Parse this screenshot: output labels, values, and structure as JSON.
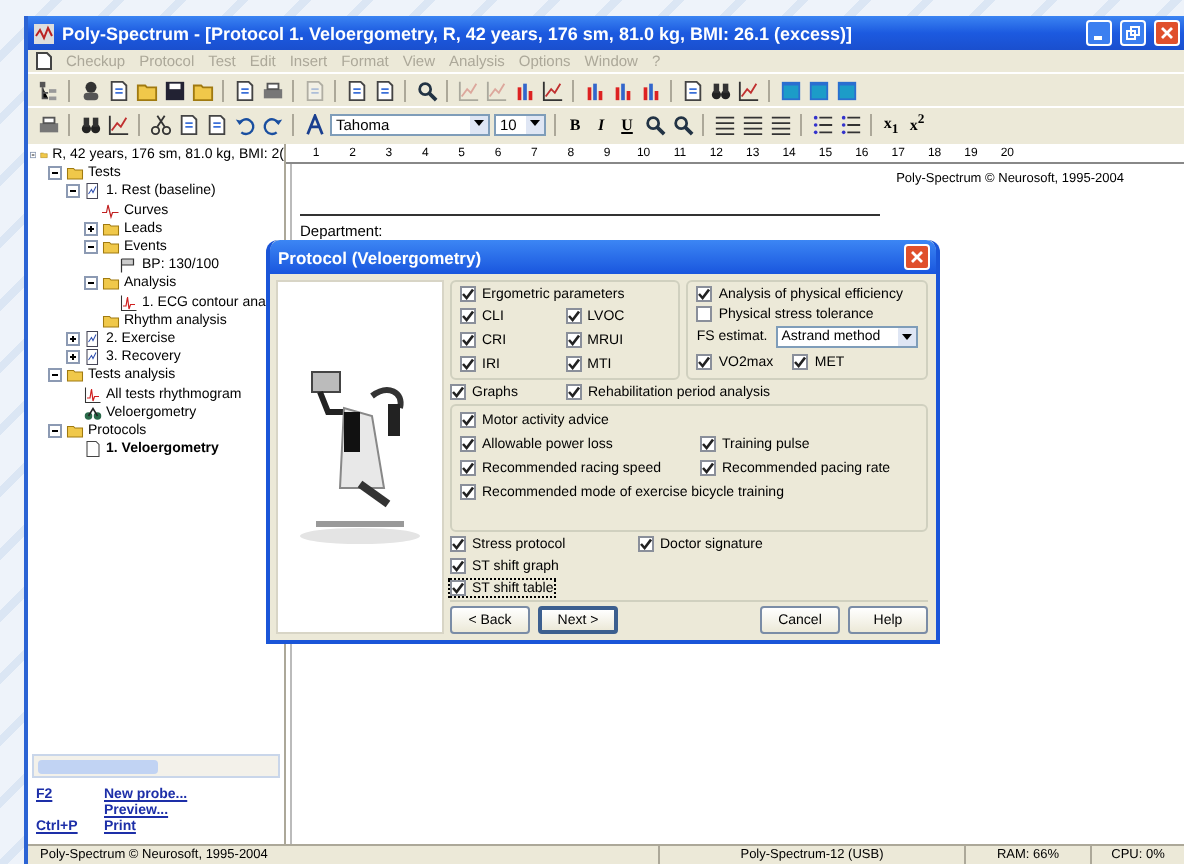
{
  "window": {
    "title": "Poly-Spectrum - [Protocol 1. Veloergometry, R, 42 years, 176 sm, 81.0 kg, BMI: 26.1 (excess)]"
  },
  "menu": [
    {
      "label": "Checkup",
      "disabled": true
    },
    {
      "label": "Protocol",
      "disabled": true
    },
    {
      "label": "Test",
      "disabled": true
    },
    {
      "label": "Edit",
      "disabled": true
    },
    {
      "label": "Insert",
      "disabled": true
    },
    {
      "label": "Format",
      "disabled": true
    },
    {
      "label": "View",
      "disabled": true
    },
    {
      "label": "Analysis",
      "disabled": true
    },
    {
      "label": "Options",
      "disabled": true
    },
    {
      "label": "Window",
      "disabled": true
    },
    {
      "label": "?",
      "disabled": true
    }
  ],
  "toolbar_1": [
    {
      "kind": "tree",
      "disabled": false
    },
    {
      "kind": "sep"
    },
    {
      "kind": "person",
      "disabled": false
    },
    {
      "kind": "doc",
      "disabled": false
    },
    {
      "kind": "folder",
      "disabled": false
    },
    {
      "kind": "save",
      "disabled": false
    },
    {
      "kind": "folder",
      "disabled": false
    },
    {
      "kind": "sep"
    },
    {
      "kind": "doc",
      "disabled": false
    },
    {
      "kind": "print",
      "disabled": false
    },
    {
      "kind": "sep"
    },
    {
      "kind": "doc",
      "disabled": true
    },
    {
      "kind": "sep"
    },
    {
      "kind": "doc",
      "disabled": false
    },
    {
      "kind": "doc",
      "disabled": false
    },
    {
      "kind": "sep"
    },
    {
      "kind": "search",
      "disabled": false
    },
    {
      "kind": "sep"
    },
    {
      "kind": "chart",
      "disabled": true
    },
    {
      "kind": "chart",
      "disabled": true
    },
    {
      "kind": "bars",
      "disabled": false
    },
    {
      "kind": "chart",
      "disabled": false
    },
    {
      "kind": "sep"
    },
    {
      "kind": "bars",
      "disabled": false
    },
    {
      "kind": "bars",
      "disabled": false
    },
    {
      "kind": "bars",
      "disabled": false
    },
    {
      "kind": "sep"
    },
    {
      "kind": "doc",
      "disabled": false
    },
    {
      "kind": "binoculars",
      "disabled": false
    },
    {
      "kind": "chart",
      "disabled": false
    },
    {
      "kind": "sep"
    },
    {
      "kind": "window",
      "disabled": false
    },
    {
      "kind": "window",
      "disabled": false
    },
    {
      "kind": "window",
      "disabled": false
    }
  ],
  "toolbar_2": {
    "before": [
      {
        "kind": "print",
        "disabled": false
      },
      {
        "kind": "sep"
      },
      {
        "kind": "binoculars",
        "disabled": false
      },
      {
        "kind": "chart",
        "disabled": false
      },
      {
        "kind": "sep"
      },
      {
        "kind": "cut",
        "disabled": false
      },
      {
        "kind": "doc",
        "disabled": false
      },
      {
        "kind": "doc",
        "disabled": false
      },
      {
        "kind": "undo",
        "disabled": false
      },
      {
        "kind": "redo",
        "disabled": false
      },
      {
        "kind": "sep"
      },
      {
        "kind": "font",
        "disabled": false
      }
    ],
    "font": "Tahoma",
    "size": "10",
    "format": [
      "B",
      "I",
      "U"
    ],
    "after": [
      {
        "kind": "search",
        "disabled": false
      },
      {
        "kind": "search",
        "disabled": false
      },
      {
        "kind": "sep"
      },
      {
        "kind": "align",
        "disabled": false
      },
      {
        "kind": "align",
        "disabled": false
      },
      {
        "kind": "align",
        "disabled": false
      },
      {
        "kind": "sep"
      },
      {
        "kind": "list",
        "disabled": false
      },
      {
        "kind": "list",
        "disabled": false
      },
      {
        "kind": "sep"
      }
    ],
    "scripts": [
      "x$_{1}$",
      "x$^{2}$"
    ]
  },
  "tree": [
    {
      "label": "R, 42 years, 176 sm, 81.0 kg, BMI: 2(",
      "kind": "folder",
      "expanded": true,
      "children": [
        {
          "label": "Tests",
          "kind": "folder",
          "expanded": true,
          "children": [
            {
              "label": "1. Rest (baseline)",
              "kind": "test",
              "expanded": true,
              "children": [
                {
                  "label": "Curves",
                  "kind": "curve"
                },
                {
                  "label": "Leads",
                  "kind": "folder",
                  "expanded": false
                },
                {
                  "label": "Events",
                  "kind": "folder",
                  "expanded": true,
                  "children": [
                    {
                      "label": "BP: 130/100",
                      "kind": "events"
                    }
                  ]
                },
                {
                  "label": "Analysis",
                  "kind": "folder",
                  "expanded": true,
                  "children": [
                    {
                      "label": "1. ECG contour ana",
                      "kind": "ecg"
                    }
                  ]
                },
                {
                  "label": "Rhythm analysis",
                  "kind": "folder"
                }
              ]
            },
            {
              "label": "2. Exercise",
              "kind": "test",
              "expanded": false
            },
            {
              "label": "3. Recovery",
              "kind": "test",
              "expanded": false
            }
          ]
        },
        {
          "label": "Tests analysis",
          "kind": "folder",
          "expanded": true,
          "children": [
            {
              "label": "All tests rhythmogram",
              "kind": "ecg"
            },
            {
              "label": "Veloergometry",
              "kind": "bike"
            }
          ]
        },
        {
          "label": "Protocols",
          "kind": "folder",
          "expanded": true,
          "children": [
            {
              "label": "1. Veloergometry",
              "kind": "protocol"
            }
          ]
        }
      ]
    }
  ],
  "shortcuts": [
    {
      "key": "F2",
      "action": "New probe..."
    },
    {
      "action": "Preview..."
    },
    {
      "key": "Ctrl+P",
      "action": "Print"
    }
  ],
  "ruler": [
    "1",
    "2",
    "3",
    "4",
    "5",
    "6",
    "7",
    "8",
    "9",
    "10",
    "11",
    "12",
    "13",
    "14",
    "15",
    "16",
    "17",
    "18",
    "19",
    "20"
  ],
  "document": {
    "copyright": "Poly-Spectrum © Neurosoft, 1995-2004",
    "department": "Department:"
  },
  "dialog": {
    "title": "Protocol (Veloergometry)",
    "left_group": {
      "header": {
        "label": "Ergometric parameters",
        "checked": true
      },
      "rows": [
        [
          {
            "label": "CLI",
            "checked": true
          },
          {
            "label": "LVOC",
            "checked": true
          }
        ],
        [
          {
            "label": "CRI",
            "checked": true
          },
          {
            "label": "MRUI",
            "checked": true
          }
        ],
        [
          {
            "label": "IRI",
            "checked": true
          },
          {
            "label": "MTI",
            "checked": true
          }
        ]
      ]
    },
    "right_group": {
      "header": {
        "label": "Analysis of physical efficiency",
        "checked": true
      },
      "option": {
        "label": "Physical stress tolerance",
        "checked": false
      },
      "estimate_label": "FS estimat.",
      "estimate_value": "Astrand method",
      "measures": [
        {
          "label": "VO2max",
          "checked": true
        },
        {
          "label": "MET",
          "checked": true
        }
      ]
    },
    "middle_row": [
      {
        "label": "Graphs",
        "checked": true
      },
      {
        "label": "Rehabilitation period analysis",
        "checked": true
      }
    ],
    "advice_group": [
      [
        {
          "label": "Motor activity advice",
          "checked": true
        }
      ],
      [
        {
          "label": "Allowable power loss",
          "checked": true
        },
        {
          "label": "Training pulse",
          "checked": true
        }
      ],
      [
        {
          "label": "Recommended racing speed",
          "checked": true
        },
        {
          "label": "Recommended pacing rate",
          "checked": true
        }
      ],
      [
        {
          "label": "Recommended mode of exercise bicycle training",
          "checked": true
        }
      ]
    ],
    "bottom_rows": [
      [
        {
          "label": "Stress protocol",
          "checked": true,
          "focused": false
        },
        {
          "label": "Doctor signature",
          "checked": true,
          "focused": false
        }
      ],
      [
        {
          "label": "ST shift graph",
          "checked": true,
          "focused": false
        }
      ],
      [
        {
          "label": "ST shift table",
          "checked": true,
          "focused": true
        }
      ]
    ],
    "buttons": [
      {
        "label": "< Back",
        "default": false
      },
      {
        "label": "Next >",
        "default": true
      },
      {
        "label": "Cancel",
        "default": false
      },
      {
        "label": "Help",
        "default": false
      }
    ]
  },
  "status_bar": [
    "Poly-Spectrum © Neurosoft, 1995-2004",
    "Poly-Spectrum-12 (USB)",
    "RAM: 66%",
    "CPU: 0%"
  ]
}
